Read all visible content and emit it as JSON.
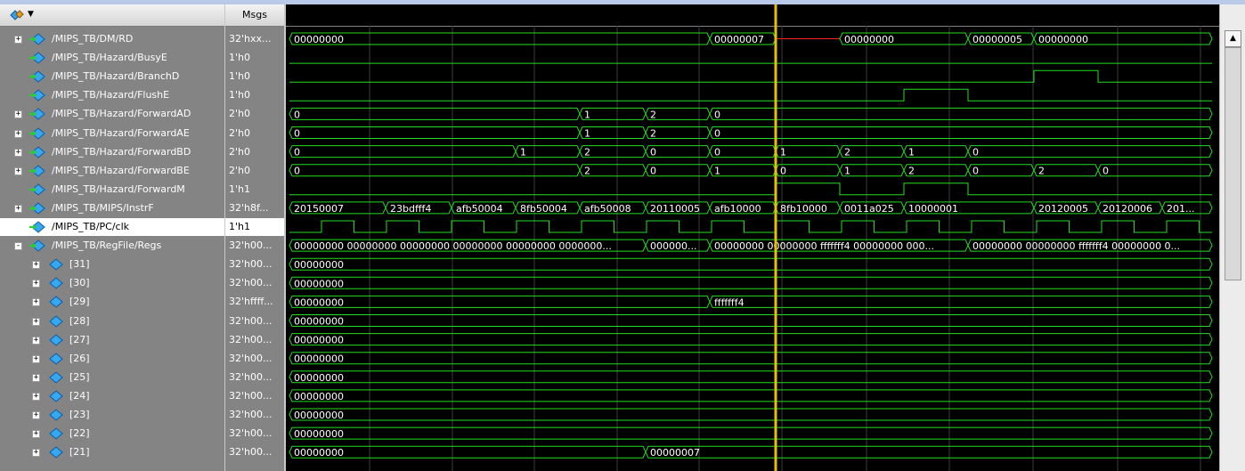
{
  "header": {
    "msgs_label": "Msgs",
    "toolbar_icon": "wave-add-icon",
    "dropdown_icon": "chevron-down-icon"
  },
  "colors": {
    "wave": "#22dd22",
    "cursor": "#e8c000",
    "unknown": "#ff2020",
    "signal_text": "#ffffff",
    "panel": "#848484"
  },
  "signals": [
    {
      "name": "/MIPS_TB/DM/RD",
      "value": "32'hxx...",
      "expandable": true,
      "expanded": false,
      "indent": 0,
      "icon": "bus-signal-icon"
    },
    {
      "name": "/MIPS_TB/Hazard/BusyE",
      "value": "1'h0",
      "expandable": false,
      "indent": 0,
      "icon": "signal-icon"
    },
    {
      "name": "/MIPS_TB/Hazard/BranchD",
      "value": "1'h0",
      "expandable": false,
      "indent": 0,
      "icon": "signal-icon"
    },
    {
      "name": "/MIPS_TB/Hazard/FlushE",
      "value": "1'h0",
      "expandable": false,
      "indent": 0,
      "icon": "signal-icon"
    },
    {
      "name": "/MIPS_TB/Hazard/ForwardAD",
      "value": "2'h0",
      "expandable": true,
      "expanded": false,
      "indent": 0,
      "icon": "bus-signal-icon"
    },
    {
      "name": "/MIPS_TB/Hazard/ForwardAE",
      "value": "2'h0",
      "expandable": true,
      "expanded": false,
      "indent": 0,
      "icon": "bus-signal-icon"
    },
    {
      "name": "/MIPS_TB/Hazard/ForwardBD",
      "value": "2'h0",
      "expandable": true,
      "expanded": false,
      "indent": 0,
      "icon": "bus-signal-icon"
    },
    {
      "name": "/MIPS_TB/Hazard/ForwardBE",
      "value": "2'h0",
      "expandable": true,
      "expanded": false,
      "indent": 0,
      "icon": "bus-signal-icon"
    },
    {
      "name": "/MIPS_TB/Hazard/ForwardM",
      "value": "1'h1",
      "expandable": false,
      "indent": 0,
      "icon": "signal-icon"
    },
    {
      "name": "/MIPS_TB/MIPS/InstrF",
      "value": "32'h8f...",
      "expandable": true,
      "expanded": false,
      "indent": 0,
      "icon": "bus-signal-icon"
    },
    {
      "name": "/MIPS_TB/PC/clk",
      "value": "1'h1",
      "expandable": false,
      "indent": 0,
      "icon": "signal-icon",
      "selected": true
    },
    {
      "name": "/MIPS_TB/RegFile/Regs",
      "value": "32'h00...",
      "expandable": true,
      "expanded": true,
      "indent": 0,
      "icon": "bus-signal-icon"
    },
    {
      "name": "[31]",
      "value": "32'h00...",
      "expandable": true,
      "expanded": false,
      "indent": 1,
      "icon": "bus-signal-icon"
    },
    {
      "name": "[30]",
      "value": "32'h00...",
      "expandable": true,
      "expanded": false,
      "indent": 1,
      "icon": "bus-signal-icon"
    },
    {
      "name": "[29]",
      "value": "32'hffff...",
      "expandable": true,
      "expanded": false,
      "indent": 1,
      "icon": "bus-signal-icon"
    },
    {
      "name": "[28]",
      "value": "32'h00...",
      "expandable": true,
      "expanded": false,
      "indent": 1,
      "icon": "bus-signal-icon"
    },
    {
      "name": "[27]",
      "value": "32'h00...",
      "expandable": true,
      "expanded": false,
      "indent": 1,
      "icon": "bus-signal-icon"
    },
    {
      "name": "[26]",
      "value": "32'h00...",
      "expandable": true,
      "expanded": false,
      "indent": 1,
      "icon": "bus-signal-icon"
    },
    {
      "name": "[25]",
      "value": "32'h00...",
      "expandable": true,
      "expanded": false,
      "indent": 1,
      "icon": "bus-signal-icon"
    },
    {
      "name": "[24]",
      "value": "32'h00...",
      "expandable": true,
      "expanded": false,
      "indent": 1,
      "icon": "bus-signal-icon"
    },
    {
      "name": "[23]",
      "value": "32'h00...",
      "expandable": true,
      "expanded": false,
      "indent": 1,
      "icon": "bus-signal-icon"
    },
    {
      "name": "[22]",
      "value": "32'h00...",
      "expandable": true,
      "expanded": false,
      "indent": 1,
      "icon": "bus-signal-icon"
    },
    {
      "name": "[21]",
      "value": "32'h00...",
      "expandable": true,
      "expanded": false,
      "indent": 1,
      "icon": "bus-signal-icon"
    }
  ],
  "waveforms": [
    {
      "kind": "bus",
      "segments": [
        {
          "label": "00000000"
        },
        {
          "label": "00000007"
        },
        {
          "label": "",
          "unknown": true
        },
        {
          "label": "00000000"
        },
        {
          "label": "00000005"
        },
        {
          "label": "00000000"
        }
      ]
    },
    {
      "kind": "bit",
      "levels": "0"
    },
    {
      "kind": "bit",
      "levels": "0 1 0"
    },
    {
      "kind": "bit",
      "levels": "0 1 0"
    },
    {
      "kind": "bus",
      "segments": [
        {
          "label": "0"
        },
        {
          "label": "1"
        },
        {
          "label": "2"
        },
        {
          "label": "0"
        }
      ]
    },
    {
      "kind": "bus",
      "segments": [
        {
          "label": "0"
        },
        {
          "label": "1"
        },
        {
          "label": "2"
        },
        {
          "label": "0"
        }
      ]
    },
    {
      "kind": "bus",
      "segments": [
        {
          "label": "0"
        },
        {
          "label": "1"
        },
        {
          "label": "2"
        },
        {
          "label": "0"
        },
        {
          "label": "0"
        },
        {
          "label": "1"
        },
        {
          "label": "2"
        },
        {
          "label": "1"
        },
        {
          "label": "0"
        }
      ]
    },
    {
      "kind": "bus",
      "segments": [
        {
          "label": "0"
        },
        {
          "label": "2"
        },
        {
          "label": "0"
        },
        {
          "label": "1"
        },
        {
          "label": "0"
        },
        {
          "label": "1"
        },
        {
          "label": "2"
        },
        {
          "label": "0"
        },
        {
          "label": "2"
        },
        {
          "label": "0"
        }
      ]
    },
    {
      "kind": "bit",
      "levels": "0 1 0 1 0"
    },
    {
      "kind": "bus",
      "segments": [
        {
          "label": "20150007"
        },
        {
          "label": "23bdfff4"
        },
        {
          "label": "afb50004"
        },
        {
          "label": "8fb50004"
        },
        {
          "label": "afb50008"
        },
        {
          "label": "20110005"
        },
        {
          "label": "afb10000"
        },
        {
          "label": "8fb10000"
        },
        {
          "label": "0011a025"
        },
        {
          "label": "10000001"
        },
        {
          "label": "20120005"
        },
        {
          "label": "20120006"
        },
        {
          "label": "201..."
        }
      ]
    },
    {
      "kind": "clock"
    },
    {
      "kind": "bus",
      "segments": [
        {
          "label": "00000000 00000000 00000000 00000000 00000000 0000000..."
        },
        {
          "label": "000000..."
        },
        {
          "label": "00000000 00000000 fffffff4 00000000 000..."
        },
        {
          "label": "00000000 00000000 fffffff4 00000000 0..."
        }
      ]
    },
    {
      "kind": "bus",
      "segments": [
        {
          "label": "00000000"
        }
      ]
    },
    {
      "kind": "bus",
      "segments": [
        {
          "label": "00000000"
        }
      ]
    },
    {
      "kind": "bus",
      "segments": [
        {
          "label": "00000000"
        },
        {
          "label": "fffffff4"
        }
      ]
    },
    {
      "kind": "bus",
      "segments": [
        {
          "label": "00000000"
        }
      ]
    },
    {
      "kind": "bus",
      "segments": [
        {
          "label": "00000000"
        }
      ]
    },
    {
      "kind": "bus",
      "segments": [
        {
          "label": "00000000"
        }
      ]
    },
    {
      "kind": "bus",
      "segments": [
        {
          "label": "00000000"
        }
      ]
    },
    {
      "kind": "bus",
      "segments": [
        {
          "label": "00000000"
        }
      ]
    },
    {
      "kind": "bus",
      "segments": [
        {
          "label": "00000000"
        }
      ]
    },
    {
      "kind": "bus",
      "segments": [
        {
          "label": "00000000"
        }
      ]
    },
    {
      "kind": "bus",
      "segments": [
        {
          "label": "00000000"
        },
        {
          "label": "00000007"
        }
      ]
    }
  ],
  "scrollbar": {
    "up_icon": "scroll-up-icon"
  }
}
